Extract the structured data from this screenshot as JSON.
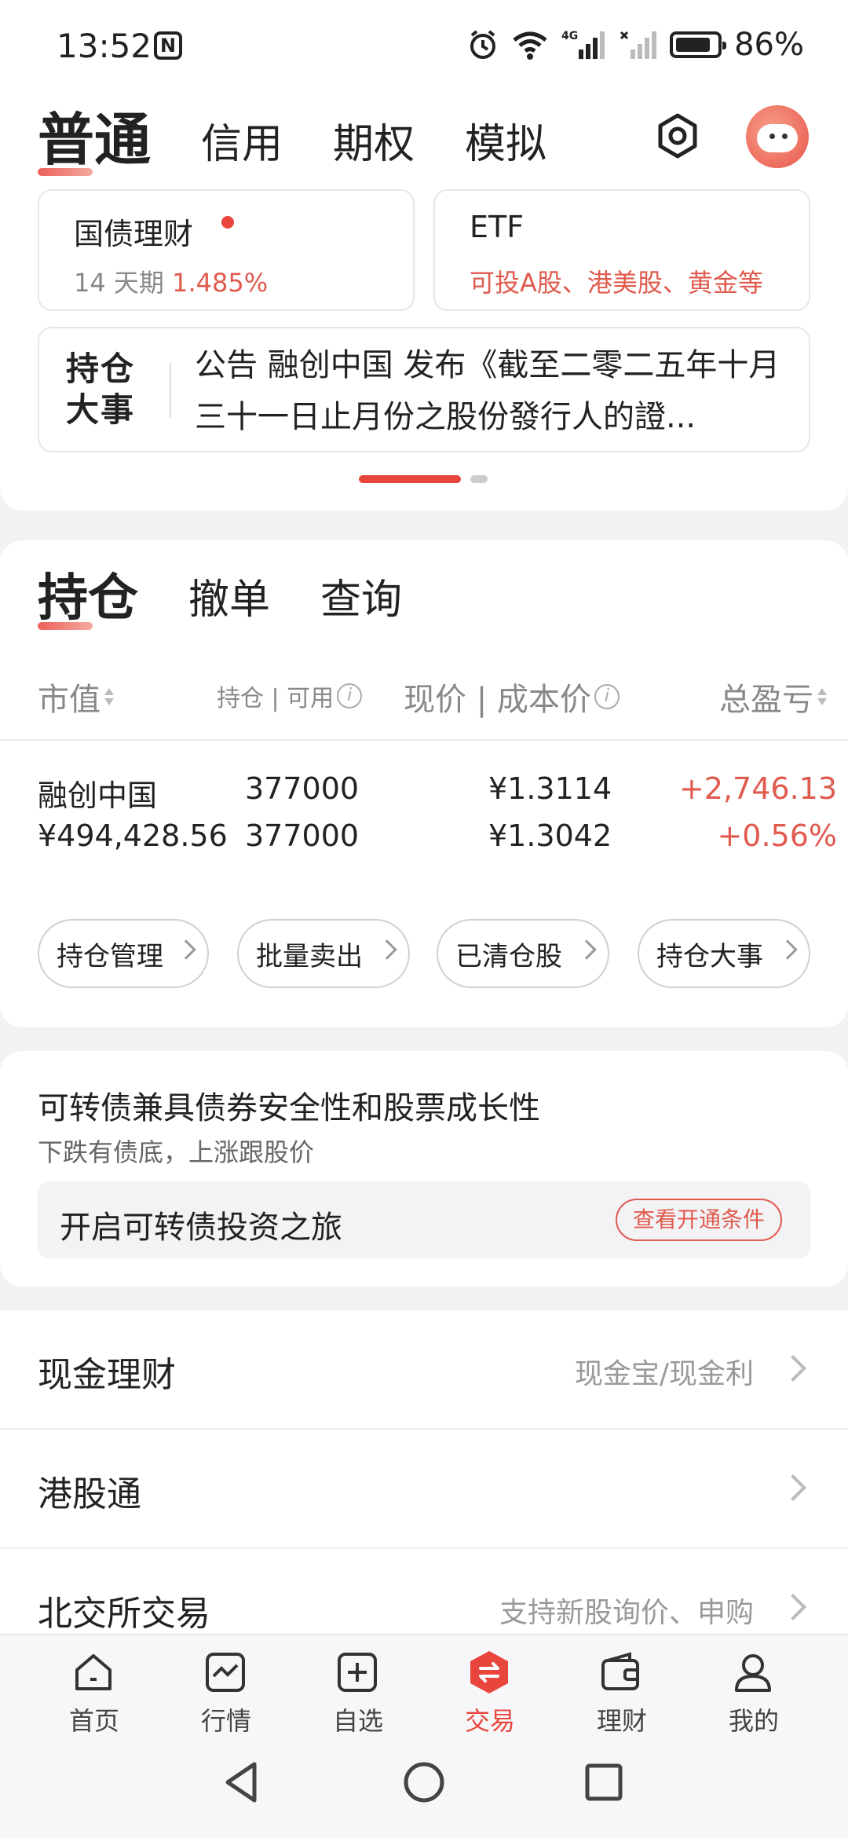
{
  "status_bar": {
    "time": "13:52",
    "nfc_icon": "N",
    "network_label": "4G",
    "battery_level": 0.86,
    "battery_text": "86%"
  },
  "account_tabs": [
    "普通",
    "信用",
    "期权",
    "模拟"
  ],
  "account_active_index": 0,
  "promos": {
    "bond": {
      "title": "国债理财",
      "sub_prefix": "14 天期",
      "sub_value": "1.485%"
    },
    "etf": {
      "title": "ETF",
      "sub": "可投A股、港美股、黄金等"
    }
  },
  "news": {
    "badge_line1": "持仓",
    "badge_line2": "大事",
    "text": "公告 融创中国 发布《截至二零二五年十月三十一日止月份之股份發行人的證..."
  },
  "holding_tabs": [
    "持仓",
    "撤单",
    "查询"
  ],
  "columns": {
    "market_value": "市值",
    "position_available": "持仓 | 可用",
    "price_cost": "现价 | 成本价",
    "total_pl": "总盈亏"
  },
  "holdings": [
    {
      "name": "融创中国",
      "market_value": "¥494,428.56",
      "position": "377000",
      "available": "377000",
      "price": "¥1.3114",
      "cost": "¥1.3042",
      "pl": "+2,746.13",
      "pl_pct": "+0.56%"
    }
  ],
  "pills": [
    "持仓管理",
    "批量卖出",
    "已清仓股",
    "持仓大事"
  ],
  "convertible": {
    "title": "可转债兼具债券安全性和股票成长性",
    "subtitle": "下跌有债底，上涨跟股价",
    "box_text": "开启可转债投资之旅",
    "button": "查看开通条件"
  },
  "list": [
    {
      "label": "现金理财",
      "hint": "现金宝/现金利"
    },
    {
      "label": "港股通",
      "hint": ""
    },
    {
      "label": "北交所交易",
      "hint": "支持新股询价、申购"
    }
  ],
  "bottom_nav": [
    {
      "label": "首页",
      "icon": "home-icon"
    },
    {
      "label": "行情",
      "icon": "chart-icon"
    },
    {
      "label": "自选",
      "icon": "add-square-icon"
    },
    {
      "label": "交易",
      "icon": "trade-icon"
    },
    {
      "label": "理财",
      "icon": "wallet-icon"
    },
    {
      "label": "我的",
      "icon": "user-icon"
    }
  ],
  "bottom_nav_active_index": 3,
  "colors": {
    "accent_red": "#e8453c",
    "gain_red": "#e05a4e",
    "muted": "#888888"
  }
}
